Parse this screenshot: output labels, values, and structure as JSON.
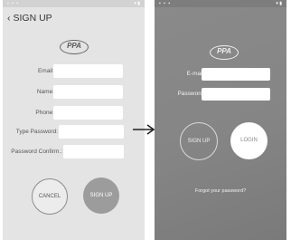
{
  "signup_screen": {
    "back_icon": "chevron-left-icon",
    "title": "SIGN UP",
    "logo_text": "PPA",
    "fields": [
      {
        "label": "Email:",
        "value": ""
      },
      {
        "label": "Name:",
        "value": ""
      },
      {
        "label": "Phone:",
        "value": ""
      },
      {
        "label": "Type Password:",
        "value": ""
      },
      {
        "label": "Password Confirm.:",
        "value": ""
      }
    ],
    "cancel_label": "CANCEL",
    "signup_label": "SIGN UP"
  },
  "arrow_icon": "arrow-right-icon",
  "login_screen": {
    "logo_text": "PPA",
    "fields": [
      {
        "label": "E-mail",
        "value": ""
      },
      {
        "label": "Password",
        "value": ""
      }
    ],
    "signup_label": "SIGN UP",
    "login_label": "LOGIN",
    "forgot_label": "Forgot your password?"
  },
  "colors": {
    "signup_bg": "#e4e4e4",
    "login_bg": "#858585",
    "signup_button": "#9c9c9c"
  }
}
